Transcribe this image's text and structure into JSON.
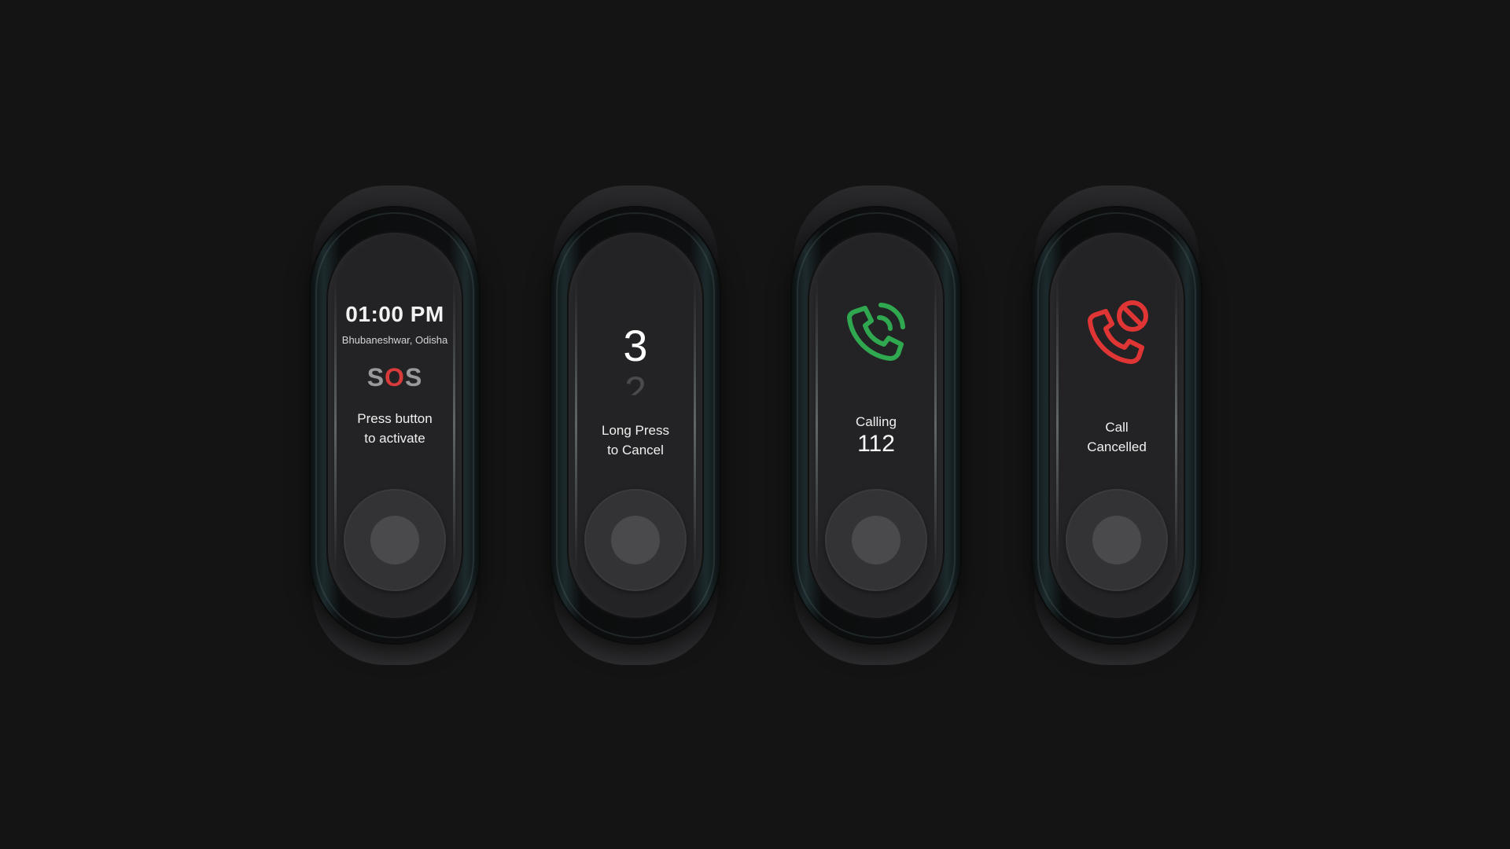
{
  "screens": [
    {
      "time": "01:00 PM",
      "location": "Bhubaneshwar, Odisha",
      "sos": {
        "s1": "S",
        "o": "O",
        "s2": "S"
      },
      "message_line1": "Press button",
      "message_line2": "to activate"
    },
    {
      "count_current": "3",
      "count_next": "2",
      "message_line1": "Long Press",
      "message_line2": "to Cancel"
    },
    {
      "icon": "phone-calling-icon",
      "label": "Calling",
      "number": "112"
    },
    {
      "icon": "phone-cancelled-icon",
      "message_line1": "Call",
      "message_line2": "Cancelled"
    }
  ],
  "colors": {
    "background": "#141415",
    "screen": "#232325",
    "sos_accent": "#d93a3a",
    "calling_green": "#2fa84f",
    "cancel_red": "#e03535"
  }
}
